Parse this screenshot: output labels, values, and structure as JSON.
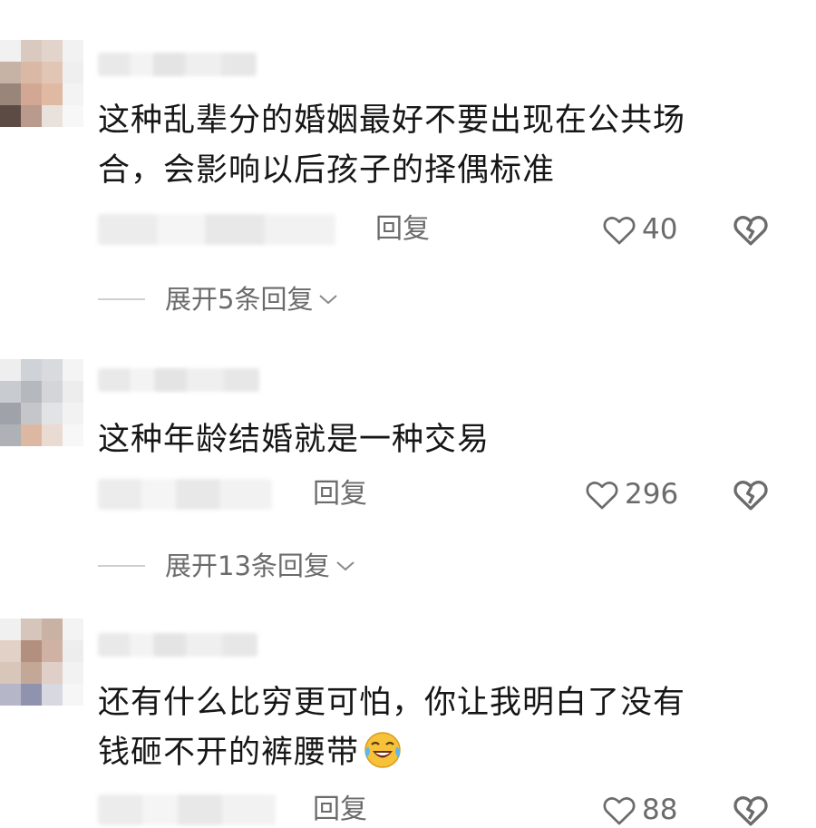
{
  "comments": [
    {
      "text_line1": "这种乱辈分的婚姻最好不要出现在公共场",
      "text_line2": "合，会影响以后孩子的择偶标准",
      "reply_label": "回复",
      "like_count": "40",
      "expand_label": "展开5条回复"
    },
    {
      "text_line1": "这种年龄结婚就是一种交易",
      "reply_label": "回复",
      "like_count": "296",
      "expand_label": "展开13条回复"
    },
    {
      "text_line1": "还有什么比穷更可怕，你让我明白了没有",
      "text_line2": "钱砸不开的裤腰带",
      "emoji": "laughing-crying-emoji",
      "reply_label": "回复",
      "like_count": "88"
    }
  ],
  "icons": {
    "like": "heart-outline-icon",
    "dislike": "broken-heart-icon",
    "expand": "chevron-down-icon"
  },
  "colors": {
    "text": "#161616",
    "meta": "#6b6b6b",
    "divider": "#cfcfcf"
  }
}
